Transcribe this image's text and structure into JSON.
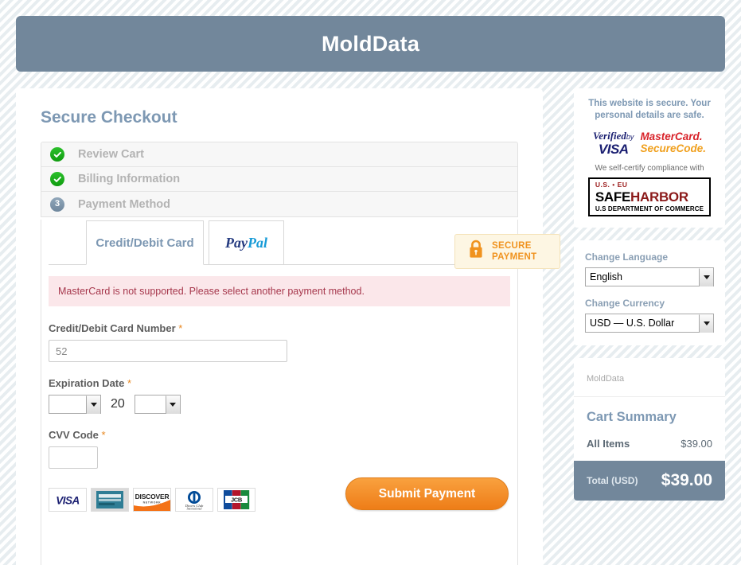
{
  "header": {
    "title": "MoldData"
  },
  "page": {
    "title": "Secure Checkout"
  },
  "steps": [
    {
      "label": "Review Cart",
      "state": "done",
      "icon": "check-icon"
    },
    {
      "label": "Billing Information",
      "state": "done",
      "icon": "check-icon"
    },
    {
      "label": "Payment Method",
      "state": "current",
      "number": "3"
    }
  ],
  "tabs": {
    "credit_card": "Credit/Debit Card",
    "paypal_pay": "Pay",
    "paypal_pal": "Pal"
  },
  "secure_badge": {
    "line1": "SECURE",
    "line2": "PAYMENT",
    "icon": "lock-icon",
    "color": "#f0931f"
  },
  "error": {
    "message": "MasterCard is not supported. Please select another payment method."
  },
  "form": {
    "card_number_label": "Credit/Debit Card Number",
    "card_number_value": "52",
    "expiration_label": "Expiration Date",
    "expiration_month": "",
    "expiration_year": "",
    "expiration_separator": "20",
    "cvv_label": "CVV Code",
    "cvv_value": "",
    "required_marker": "*"
  },
  "card_brands": [
    {
      "name": "visa",
      "label": "VISA"
    },
    {
      "name": "american-express",
      "label": "AMERICAN EXPRESS"
    },
    {
      "name": "discover",
      "label": "DISCOVER",
      "sub": "NETWORK"
    },
    {
      "name": "diners-club",
      "label": "Diners Club",
      "sub": "International"
    },
    {
      "name": "jcb",
      "label": "JCB"
    }
  ],
  "submit": {
    "label": "Submit Payment"
  },
  "sidebar": {
    "trust": {
      "heading": "This website is secure. Your personal details are safe.",
      "verified_by": "Verified",
      "by": "by",
      "visa": "VISA",
      "mastercard_top": "MasterCard.",
      "mastercard_bottom": "SecureCode.",
      "selfcert": "We self-certify compliance with",
      "safeharbor_useu": "U.S. • EU",
      "safeharbor_safe": "SAFE",
      "safeharbor_harbor": "HARBOR",
      "safeharbor_dept": "U.S DEPARTMENT OF COMMERCE"
    },
    "prefs": {
      "language_label": "Change Language",
      "language_value": "English",
      "currency_label": "Change Currency",
      "currency_value": "USD — U.S. Dollar"
    },
    "cart": {
      "brand": "MoldData",
      "title": "Cart Summary",
      "line_label": "All Items",
      "line_value": "$39.00",
      "total_label": "Total (USD)",
      "total_value": "$39.00"
    }
  }
}
